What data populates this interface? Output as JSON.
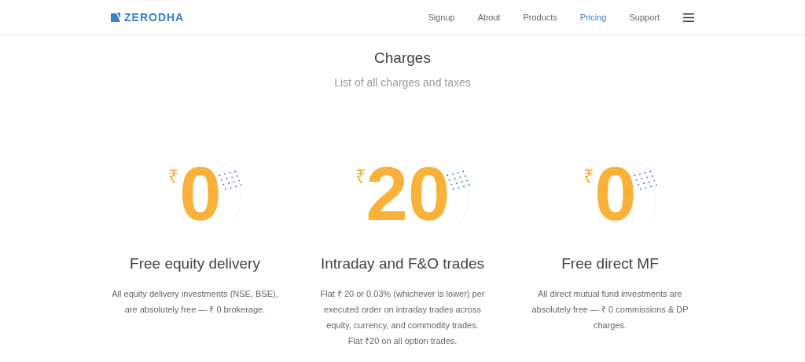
{
  "brand": {
    "name": "ZERODHA"
  },
  "nav": [
    {
      "label": "Signup",
      "selected": false
    },
    {
      "label": "About",
      "selected": false
    },
    {
      "label": "Products",
      "selected": false
    },
    {
      "label": "Pricing",
      "selected": true
    },
    {
      "label": "Support",
      "selected": false
    }
  ],
  "header": {
    "title": "Charges",
    "subtitle": "List of all charges and taxes"
  },
  "cards": [
    {
      "symbol": "₹",
      "amount": "0",
      "title": "Free equity delivery",
      "text": "All equity delivery investments (NSE, BSE), are absolutely free — ₹ 0 brokerage."
    },
    {
      "symbol": "₹",
      "amount": "20",
      "title": "Intraday and F&O trades",
      "text": "Flat ₹ 20 or 0.03% (whichever is lower) per executed order on intraday trades across equity, currency, and commodity trades. Flat ₹20 on all option trades."
    },
    {
      "symbol": "₹",
      "amount": "0",
      "title": "Free direct MF",
      "text": "All direct mutual fund investments are absolutely free — ₹ 0 commissions & DP charges."
    }
  ]
}
